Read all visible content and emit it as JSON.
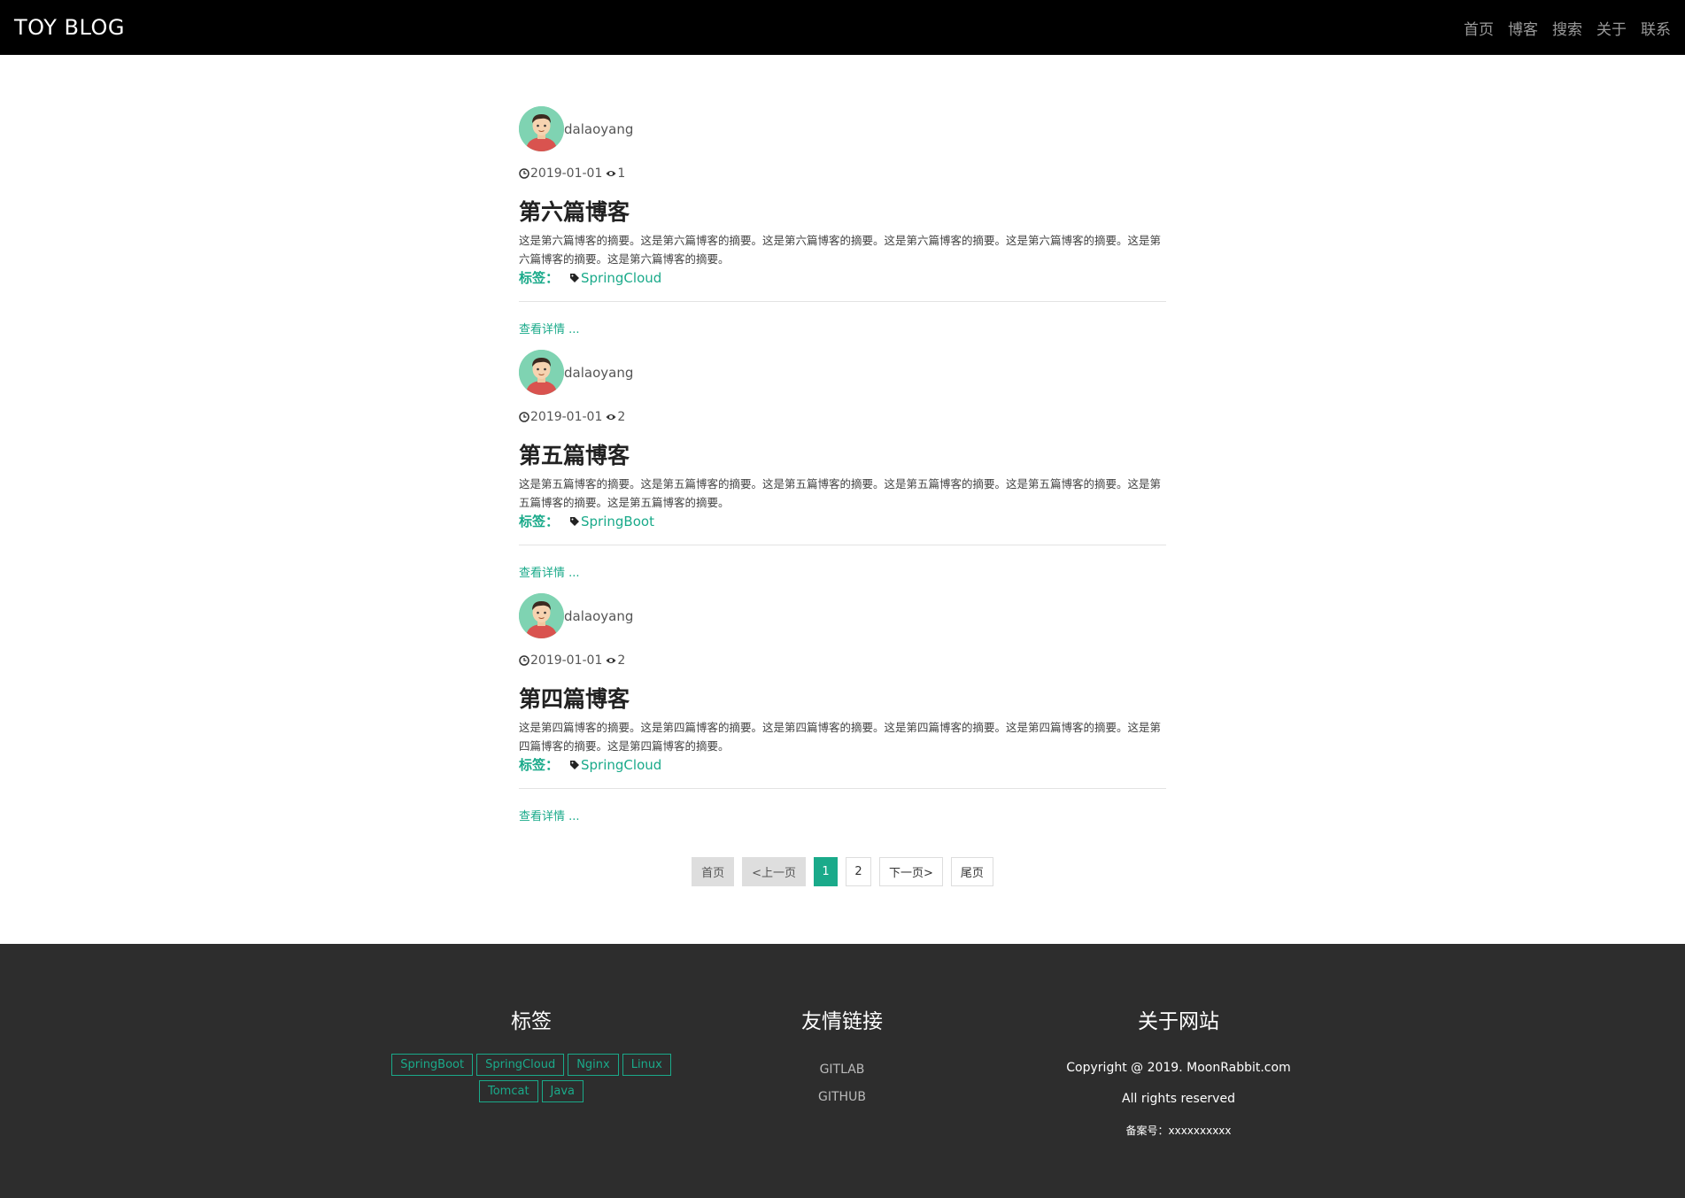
{
  "header": {
    "brand": "TOY BLOG",
    "nav": [
      "首页",
      "博客",
      "搜索",
      "关于",
      "联系"
    ]
  },
  "posts": [
    {
      "author": "dalaoyang",
      "date": "2019-01-01",
      "views": "1",
      "title": "第六篇博客",
      "summary": "这是第六篇博客的摘要。这是第六篇博客的摘要。这是第六篇博客的摘要。这是第六篇博客的摘要。这是第六篇博客的摘要。这是第六篇博客的摘要。这是第六篇博客的摘要。",
      "tags_label": "标签：",
      "tag": "SpringCloud",
      "more": "查看详情 ..."
    },
    {
      "author": "dalaoyang",
      "date": "2019-01-01",
      "views": "2",
      "title": "第五篇博客",
      "summary": "这是第五篇博客的摘要。这是第五篇博客的摘要。这是第五篇博客的摘要。这是第五篇博客的摘要。这是第五篇博客的摘要。这是第五篇博客的摘要。这是第五篇博客的摘要。",
      "tags_label": "标签：",
      "tag": "SpringBoot",
      "more": "查看详情 ..."
    },
    {
      "author": "dalaoyang",
      "date": "2019-01-01",
      "views": "2",
      "title": "第四篇博客",
      "summary": "这是第四篇博客的摘要。这是第四篇博客的摘要。这是第四篇博客的摘要。这是第四篇博客的摘要。这是第四篇博客的摘要。这是第四篇博客的摘要。这是第四篇博客的摘要。",
      "tags_label": "标签：",
      "tag": "SpringCloud",
      "more": "查看详情 ..."
    }
  ],
  "pagination": {
    "first": "首页",
    "prev": "<上一页",
    "pages": [
      "1",
      "2"
    ],
    "current": "1",
    "next": "下一页>",
    "last": "尾页"
  },
  "footer": {
    "tags_title": "标签",
    "tags": [
      "SpringBoot",
      "SpringCloud",
      "Nginx",
      "Linux",
      "Tomcat",
      "Java"
    ],
    "links_title": "友情链接",
    "links": [
      "GITLAB",
      "GITHUB"
    ],
    "about_title": "关于网站",
    "copyright": "Copyright @ 2019. MoonRabbit.com",
    "rights": "All rights reserved",
    "record": "备案号：xxxxxxxxxx"
  },
  "colors": {
    "accent": "#1aaa8a",
    "header_bg": "#000000",
    "footer_bg": "#2d2d2d"
  }
}
